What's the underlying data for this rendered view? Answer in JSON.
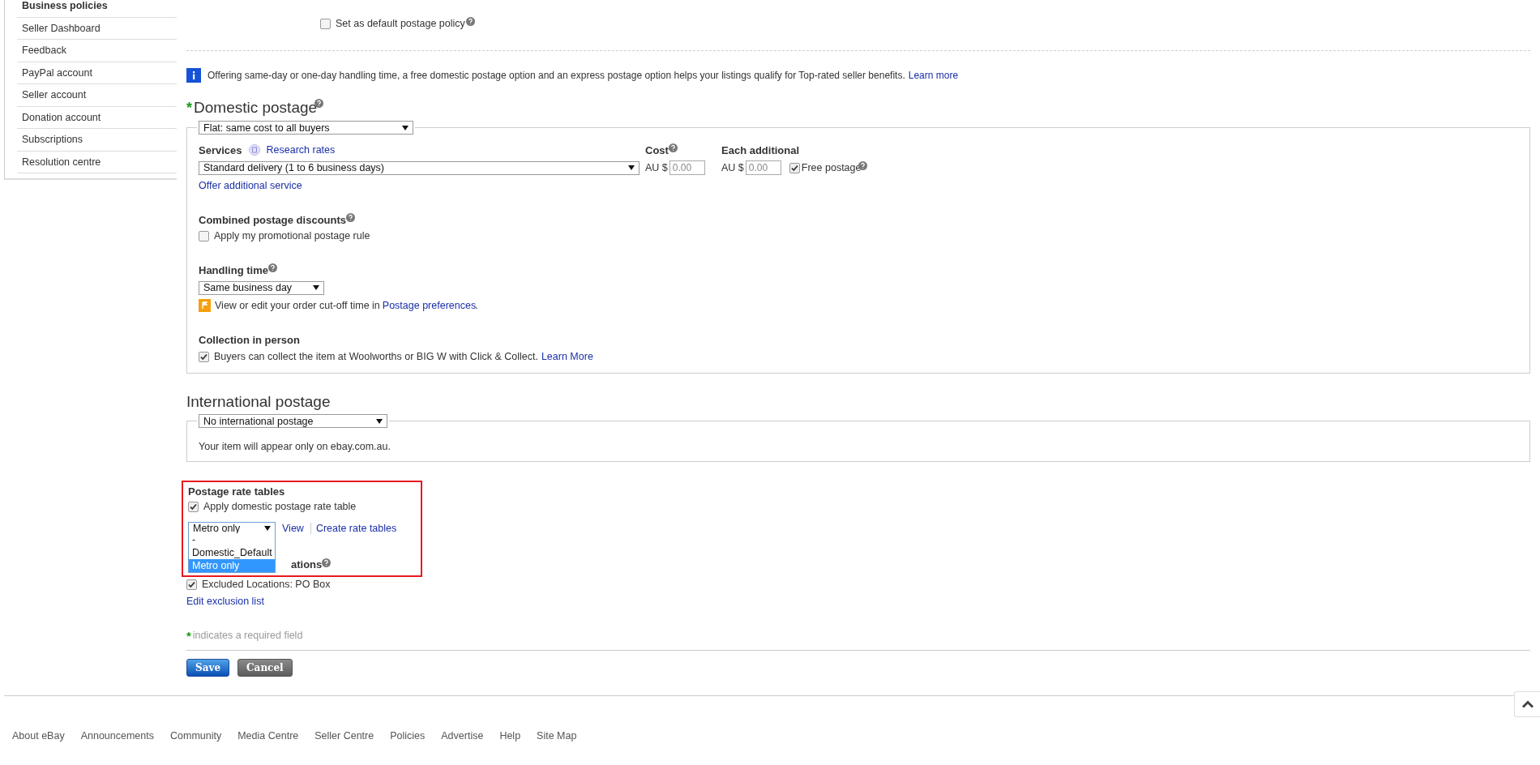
{
  "sidebar": {
    "items": [
      {
        "label": "Business policies",
        "selected": true
      },
      {
        "label": "Seller Dashboard",
        "selected": false
      },
      {
        "label": "Feedback",
        "selected": false
      },
      {
        "label": "PayPal account",
        "selected": false
      },
      {
        "label": "Seller account",
        "selected": false
      },
      {
        "label": "Donation account",
        "selected": false
      },
      {
        "label": "Subscriptions",
        "selected": false
      },
      {
        "label": "Resolution centre",
        "selected": false
      }
    ]
  },
  "default_policy": {
    "label": "Set as default postage policy",
    "checked": false
  },
  "info": {
    "text": "Offering same-day or one-day handling time, a free domestic postage option and an express postage option helps your listings qualify for Top-rated seller benefits.",
    "link": "Learn more"
  },
  "domestic": {
    "required_mark": "*",
    "title": "Domestic postage",
    "type_select": "Flat: same cost to all buyers",
    "services_label": "Services",
    "research_link": "Research rates",
    "cost_label": "Cost",
    "additional_label": "Each additional",
    "service_select": "Standard delivery (1 to 6 business days)",
    "cost": {
      "currency": "AU $",
      "placeholder": "0.00"
    },
    "additional": {
      "currency": "AU $",
      "placeholder": "0.00"
    },
    "free_postage": {
      "label": "Free postage",
      "checked": true
    },
    "offer_link": "Offer additional service",
    "combined": {
      "title": "Combined postage discounts",
      "option": {
        "label": "Apply my promotional postage rule",
        "checked": false
      }
    },
    "handling": {
      "title": "Handling time",
      "select": "Same business day",
      "note": "View or edit your order cut-off time in",
      "note_link": "Postage preferences",
      "note_end": "."
    },
    "collection": {
      "title": "Collection in person",
      "option": {
        "label": "Buyers can collect the item at Woolworths or BIG W with Click & Collect.",
        "checked": true
      },
      "link": "Learn More"
    }
  },
  "international": {
    "title": "International postage",
    "select": "No international postage",
    "note": "Your item will appear only on ebay.com.au."
  },
  "rate_tables": {
    "highlighted": true,
    "title": "Postage rate tables",
    "apply": {
      "label": "Apply domestic postage rate table",
      "checked": true
    },
    "select": "Metro only",
    "open": true,
    "options": [
      {
        "label": "-",
        "selected": false
      },
      {
        "label": "Domestic_Default",
        "selected": false
      },
      {
        "label": "Metro only",
        "selected": true
      }
    ],
    "view_link": "View",
    "create_link": "Create rate tables"
  },
  "excluded": {
    "title_visible": "ations",
    "option": {
      "label": "Excluded Locations: PO Box",
      "checked": true
    },
    "edit_link": "Edit exclusion list"
  },
  "required_note": {
    "mark": "*",
    "text": "indicates a required field"
  },
  "buttons": [
    {
      "label": "Save",
      "kind": "primary"
    },
    {
      "label": "Cancel",
      "kind": "secondary"
    }
  ],
  "footer": {
    "links": [
      "About eBay",
      "Announcements",
      "Community",
      "Media Centre",
      "Seller Centre",
      "Policies",
      "Advertise",
      "Help",
      "Site Map"
    ]
  }
}
